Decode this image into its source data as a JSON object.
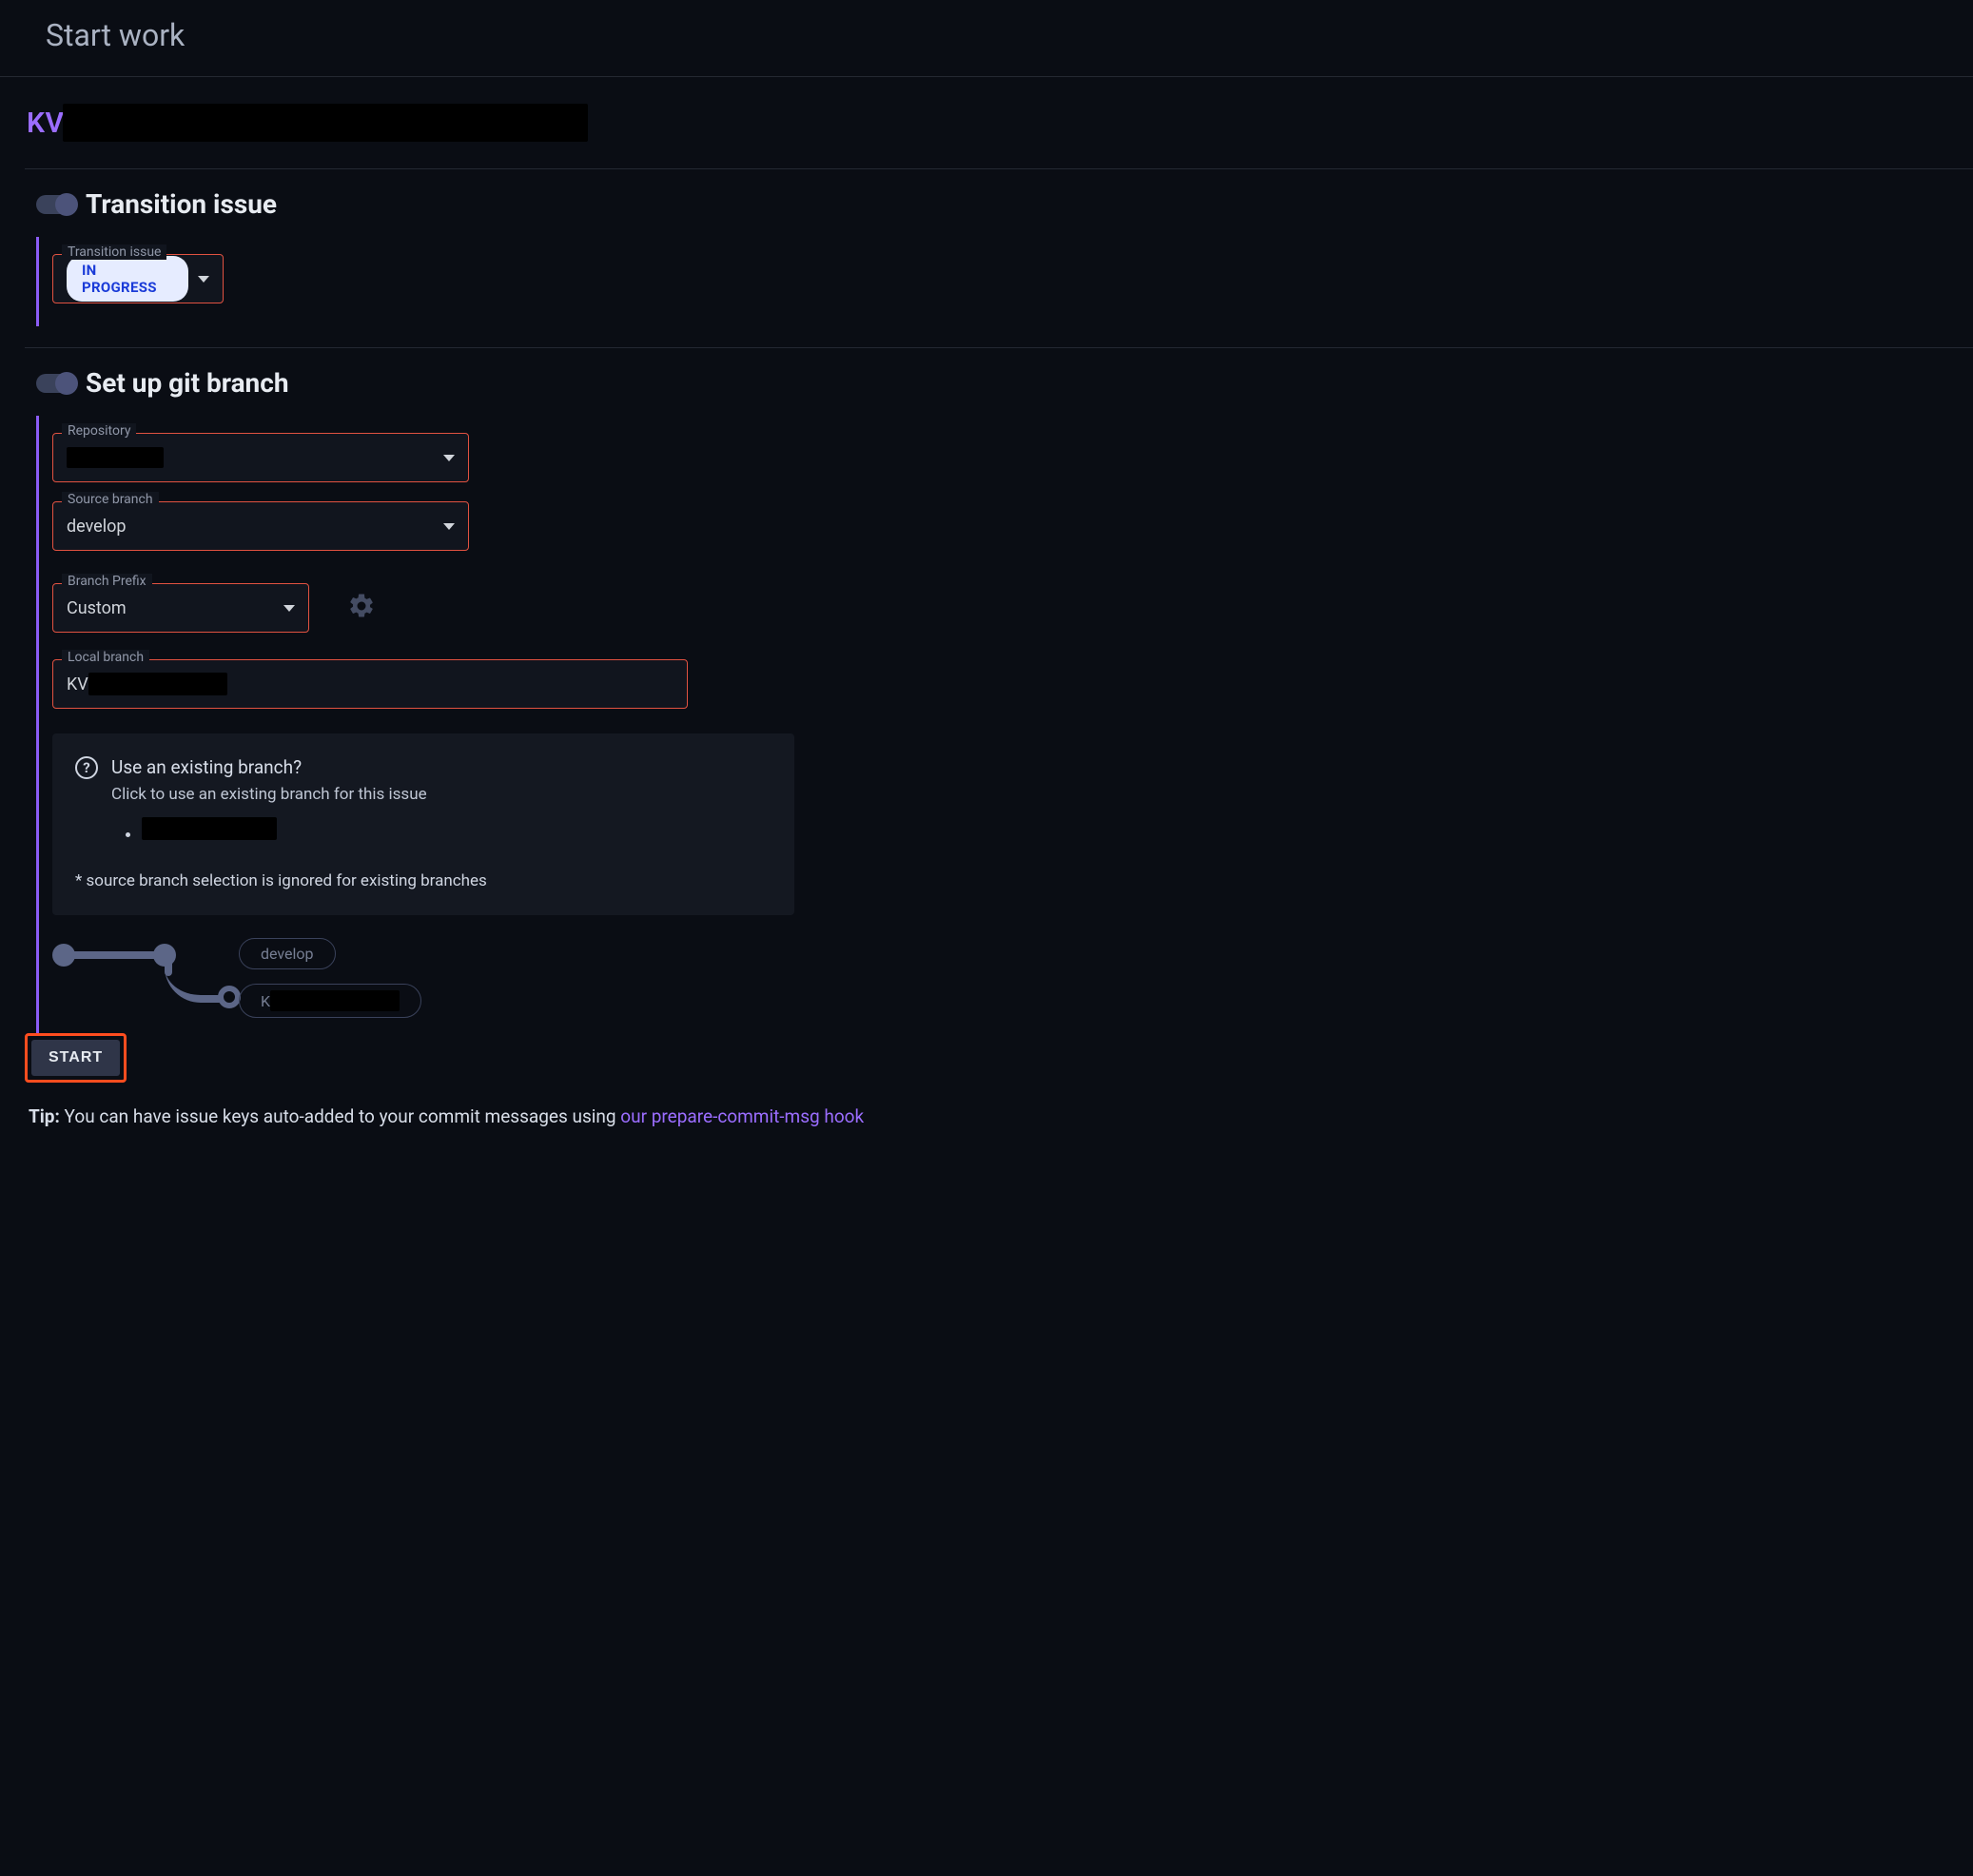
{
  "page": {
    "title": "Start work"
  },
  "issue": {
    "key_prefix": "KV"
  },
  "sections": {
    "transition": {
      "title": "Transition issue",
      "field_label": "Transition issue",
      "status": "IN PROGRESS"
    },
    "git": {
      "title": "Set up git branch",
      "repository": {
        "label": "Repository",
        "value_redacted": true
      },
      "source_branch": {
        "label": "Source branch",
        "value": "develop"
      },
      "branch_prefix": {
        "label": "Branch Prefix",
        "value": "Custom"
      },
      "local_branch": {
        "label": "Local branch",
        "value_prefix": "KV"
      },
      "existing": {
        "title": "Use an existing branch?",
        "subtitle": "Click to use an existing branch for this issue",
        "foot": "* source branch selection is ignored for existing branches"
      },
      "diagram": {
        "top_label": "develop",
        "bottom_prefix": "K"
      }
    }
  },
  "actions": {
    "start": "START"
  },
  "tip": {
    "label": "Tip:",
    "text": " You can have issue keys auto-added to your commit messages using ",
    "link": "our prepare-commit-msg hook"
  }
}
